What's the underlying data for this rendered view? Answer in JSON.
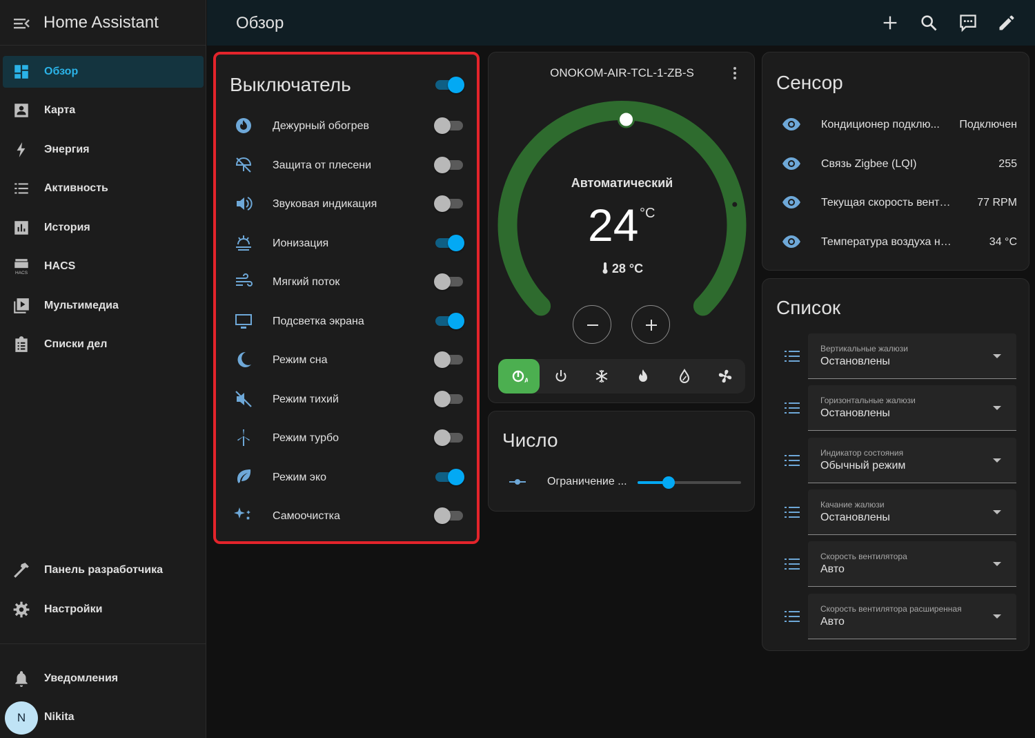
{
  "app": {
    "title": "Home Assistant"
  },
  "sidebar": {
    "items": [
      {
        "label": "Обзор",
        "icon": "view-dashboard-icon",
        "active": true
      },
      {
        "label": "Карта",
        "icon": "account-box-icon"
      },
      {
        "label": "Энергия",
        "icon": "lightning-bolt-icon"
      },
      {
        "label": "Активность",
        "icon": "format-list-bulleted-icon"
      },
      {
        "label": "История",
        "icon": "chart-box-icon"
      },
      {
        "label": "HACS",
        "icon": "hacs-icon",
        "icon_text": "HACS"
      },
      {
        "label": "Мультимедиа",
        "icon": "play-box-multiple-icon"
      },
      {
        "label": "Списки дел",
        "icon": "clipboard-list-icon"
      }
    ],
    "bottom_items": [
      {
        "label": "Панель разработчика",
        "icon": "hammer-icon"
      },
      {
        "label": "Настройки",
        "icon": "cog-icon"
      }
    ],
    "notifications": {
      "label": "Уведомления",
      "icon": "bell-icon"
    },
    "user": {
      "initial": "N",
      "name": "Nikita"
    }
  },
  "header": {
    "title": "Обзор",
    "actions": [
      "plus-icon",
      "magnify-icon",
      "comment-processing-icon",
      "pencil-icon"
    ]
  },
  "switch_card": {
    "title": "Выключатель",
    "master_on": true,
    "items": [
      {
        "label": "Дежурный обогрев",
        "icon": "fire-circle-icon",
        "on": false
      },
      {
        "label": "Защита от плесени",
        "icon": "mold-protection-icon",
        "on": false
      },
      {
        "label": "Звуковая индикация",
        "icon": "volume-high-icon",
        "on": false
      },
      {
        "label": "Ионизация",
        "icon": "ionization-icon",
        "on": true
      },
      {
        "label": "Мягкий поток",
        "icon": "weather-windy-icon",
        "on": false
      },
      {
        "label": "Подсветка экрана",
        "icon": "monitor-icon",
        "on": true
      },
      {
        "label": "Режим сна",
        "icon": "moon-icon",
        "on": false
      },
      {
        "label": "Режим тихий",
        "icon": "volume-off-icon",
        "on": false
      },
      {
        "label": "Режим турбо",
        "icon": "wind-turbine-icon",
        "on": false
      },
      {
        "label": "Режим эко",
        "icon": "leaf-icon",
        "on": true
      },
      {
        "label": "Самоочистка",
        "icon": "auto-fix-icon",
        "on": false
      }
    ]
  },
  "thermostat": {
    "name": "ONOKOM-AIR-TCL-1-ZB-S",
    "mode": "Автоматический",
    "target": "24",
    "unit": "°C",
    "current": "28 °C",
    "target_fraction": 0.5,
    "modes": [
      {
        "icon": "thermostat-auto-icon",
        "active": true
      },
      {
        "icon": "power-icon"
      },
      {
        "icon": "snowflake-icon"
      },
      {
        "icon": "fire-icon"
      },
      {
        "icon": "water-percent-icon"
      },
      {
        "icon": "fan-icon"
      }
    ],
    "colors": {
      "arc": "#2e6b2e",
      "active_mode": "#4caf50"
    }
  },
  "number_card": {
    "title": "Число",
    "label": "Ограничение ...",
    "value_fraction": 0.3
  },
  "sensor_card": {
    "title": "Сенсор",
    "items": [
      {
        "label": "Кондиционер подклю...",
        "value": "Подключен"
      },
      {
        "label": "Связь Zigbee (LQI)",
        "value": "255"
      },
      {
        "label": "Текущая скорость вентил...",
        "value": "77 RPM"
      },
      {
        "label": "Температура воздуха на ули...",
        "value": "34 °C"
      }
    ]
  },
  "list_card": {
    "title": "Список",
    "items": [
      {
        "caption": "Вертикальные жалюзи",
        "value": "Остановлены"
      },
      {
        "caption": "Горизонтальные жалюзи",
        "value": "Остановлены"
      },
      {
        "caption": "Индикатор состояния",
        "value": "Обычный режим"
      },
      {
        "caption": "Качание жалюзи",
        "value": "Остановлены"
      },
      {
        "caption": "Скорость вентилятора",
        "value": "Авто"
      },
      {
        "caption": "Скорость вентилятора расширенная",
        "value": "Авто"
      }
    ]
  },
  "colors": {
    "accent": "#03a9f4",
    "highlight_border": "#e3242b",
    "header_bg": "#101e24"
  }
}
